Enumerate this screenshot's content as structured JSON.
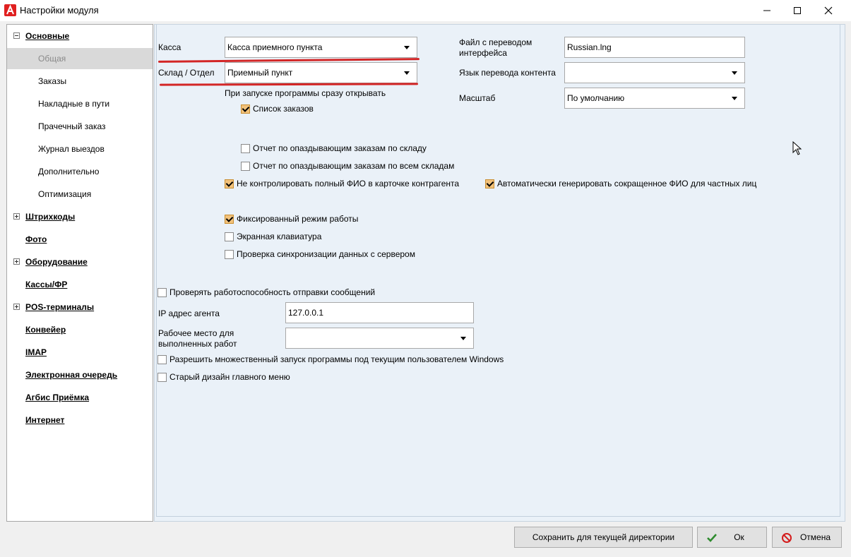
{
  "window": {
    "title": "Настройки модуля",
    "icon": "app-logo-icon",
    "controls": [
      "minimize-icon",
      "maximize-icon",
      "close-icon"
    ]
  },
  "tree": {
    "items": [
      {
        "label": "Основные",
        "level": 0,
        "expander": "minus"
      },
      {
        "label": "Общая",
        "level": 1,
        "selected": true
      },
      {
        "label": "Заказы",
        "level": 1
      },
      {
        "label": "Накладные в пути",
        "level": 1
      },
      {
        "label": "Прачечный заказ",
        "level": 1
      },
      {
        "label": "Журнал выездов",
        "level": 1
      },
      {
        "label": "Дополнительно",
        "level": 1
      },
      {
        "label": "Оптимизация",
        "level": 1
      },
      {
        "label": "Штрихкоды",
        "level": 0,
        "expander": "plus"
      },
      {
        "label": "Фото",
        "level": 0
      },
      {
        "label": "Оборудование",
        "level": 0,
        "expander": "plus"
      },
      {
        "label": "Кассы/ФР",
        "level": 0
      },
      {
        "label": "POS-терминалы",
        "level": 0,
        "expander": "plus"
      },
      {
        "label": "Конвейер",
        "level": 0
      },
      {
        "label": "IMAP",
        "level": 0
      },
      {
        "label": "Электронная очередь",
        "level": 0
      },
      {
        "label": "Агбис Приёмка",
        "level": 0
      },
      {
        "label": "Интернет",
        "level": 0
      }
    ]
  },
  "form": {
    "kassa": {
      "label": "Касса",
      "value": "Касса приемного пункта"
    },
    "sklad": {
      "label": "Склад / Отдел",
      "value": "Приемный пункт"
    },
    "startup_label": "При запуске программы сразу открывать",
    "orders_list": {
      "label": "Список заказов",
      "checked": true
    },
    "late_by_warehouse": {
      "label": "Отчет по опаздывающим заказам по складу",
      "checked": false
    },
    "late_all_warehouses": {
      "label": "Отчет по опаздывающим заказам по всем складам",
      "checked": false
    },
    "no_full_name_check": {
      "label": "Не контролировать полный ФИО в карточке контрагента",
      "checked": true
    },
    "auto_short_name": {
      "label": "Автоматически генерировать сокращенное ФИО для частных лиц",
      "checked": true
    },
    "fixed_mode": {
      "label": "Фиксированный режим работы",
      "checked": true
    },
    "screen_keyboard": {
      "label": "Экранная клавиатура",
      "checked": false
    },
    "sync_check": {
      "label": "Проверка синхронизации данных с сервером",
      "checked": false
    },
    "check_messaging": {
      "label": "Проверять работоспособность отправки сообщений",
      "checked": false
    },
    "ip_agent": {
      "label": "IP адрес агента",
      "value": "127.0.0.1"
    },
    "workplace": {
      "label_line1": "Рабочее место для",
      "label_line2": "выполненных работ",
      "value": ""
    },
    "multi_launch": {
      "label": "Разрешить множественный запуск программы под текущим пользователем Windows",
      "checked": false
    },
    "old_menu": {
      "label": "Старый дизайн главного меню",
      "checked": false
    },
    "lang_file": {
      "label_line1": "Файл с переводом",
      "label_line2": "интерфейса",
      "value": "Russian.lng"
    },
    "content_lang": {
      "label": "Язык перевода контента",
      "value": ""
    },
    "scale": {
      "label": "Масштаб",
      "value": "По умолчанию"
    }
  },
  "buttons": {
    "save_dir": "Сохранить для текущей директории",
    "ok": "Ок",
    "cancel": "Отмена"
  },
  "colors": {
    "underline_red": "#d32626",
    "check_fill": "#f2c27b",
    "panel_bg": "#eaf1f8"
  }
}
